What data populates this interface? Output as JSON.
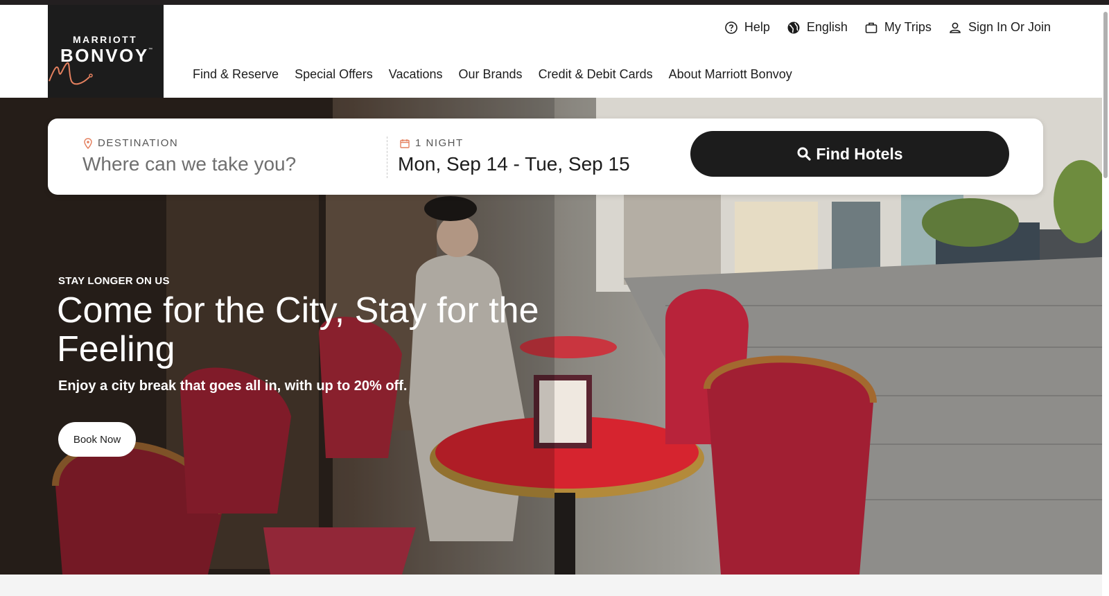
{
  "logo": {
    "line1": "MARRIOTT",
    "line2": "BONVOY",
    "tm": "™"
  },
  "utility_nav": [
    {
      "label": "Help",
      "icon": "help-circle-icon"
    },
    {
      "label": "English",
      "icon": "globe-icon"
    },
    {
      "label": "My Trips",
      "icon": "suitcase-icon"
    },
    {
      "label": "Sign In Or Join",
      "icon": "user-icon"
    }
  ],
  "main_nav": [
    "Find & Reserve",
    "Special Offers",
    "Vacations",
    "Our Brands",
    "Credit & Debit Cards",
    "About Marriott Bonvoy"
  ],
  "search": {
    "destination_label": "DESTINATION",
    "destination_placeholder": "Where can we take you?",
    "nights_label": "1 NIGHT",
    "dates": "Mon, Sep 14 - Tue, Sep 15",
    "find_button": "Find Hotels"
  },
  "hero": {
    "eyebrow": "STAY LONGER ON US",
    "headline": "Come for the City, Stay for the Feeling",
    "subhead": "Enjoy a city break that goes all in, with up to 20% off.",
    "cta": "Book Now"
  },
  "colors": {
    "brand_dark": "#1c1c1c",
    "accent_coral": "#e4805f",
    "chair_red": "#b8233a",
    "table_red": "#d6242f"
  }
}
